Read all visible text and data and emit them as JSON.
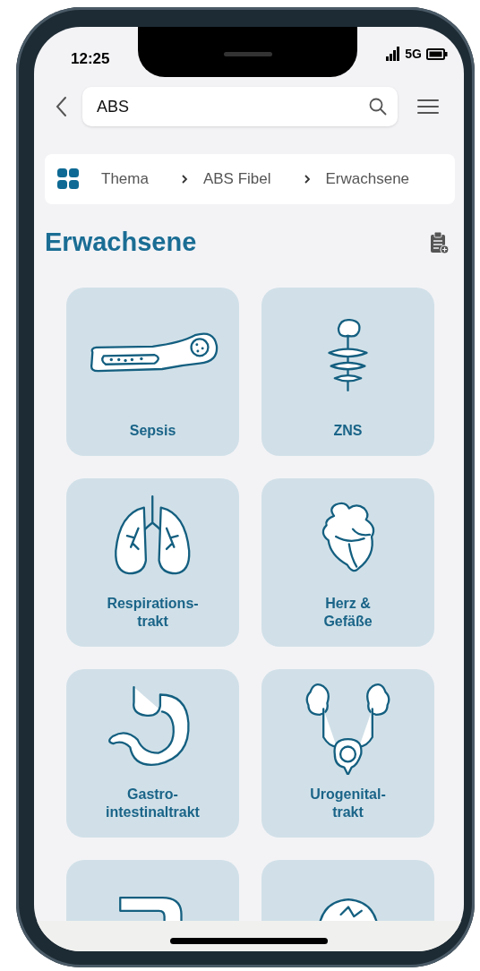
{
  "status_bar": {
    "time": "12:25",
    "network": "5G"
  },
  "search": {
    "value": "ABS"
  },
  "breadcrumb": [
    {
      "label": "Thema"
    },
    {
      "label": "ABS Fibel"
    },
    {
      "label": "Erwachsene"
    }
  ],
  "title": "Erwachsene",
  "tiles": [
    {
      "kind": "full",
      "label": "Sepsis"
    },
    {
      "kind": "full",
      "label": "ZNS"
    },
    {
      "kind": "full",
      "label": "Respirations-\ntrakt"
    },
    {
      "kind": "full",
      "label": "Herz &\nGefäße"
    },
    {
      "kind": "full",
      "label": "Gastro-\nintestinaltrakt"
    },
    {
      "kind": "full",
      "label": "Urogenital-\ntrakt"
    },
    {
      "kind": "cut"
    },
    {
      "kind": "cut"
    }
  ]
}
